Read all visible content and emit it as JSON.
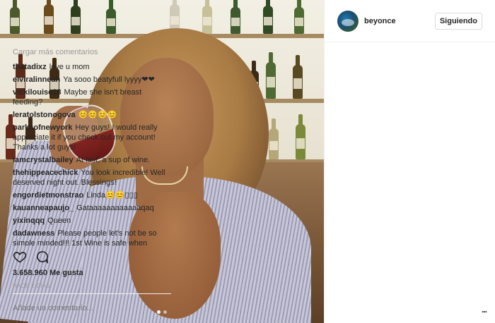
{
  "post": {
    "username": "beyonce",
    "follow_label": "Siguiendo",
    "load_more_label": "Cargar más comentarios",
    "likes_text": "3.658.960 Me gusta",
    "timestamp": "HACE 2 DÍAS",
    "comment_placeholder": "Añade un comentario...",
    "more_label": "...",
    "carousel": {
      "count": 2,
      "active_index": 0
    }
  },
  "comments": [
    {
      "user": "thatadixz",
      "text": "love u mom"
    },
    {
      "user": "elviralinneah",
      "text": "Ya sooo beatyfull lyyyy❤❤"
    },
    {
      "user": "vickilouise28",
      "text": "Maybe she isn't breast feeding?"
    },
    {
      "user": "leratolstonogova",
      "text": "😊😊😊😊"
    },
    {
      "user": "parksofnewyork",
      "text": "Hey guys! I would really appreciate it if you check out my account! Thanks a lot guys!"
    },
    {
      "user": "iamcrystalbailey",
      "text": "At last; a sup of wine."
    },
    {
      "user": "thehippeacechick",
      "text": "You look incredible! Well deserved night out. Blessings!"
    },
    {
      "user": "engordietmonstrao",
      "text": "Linda😊😊▯▯▯"
    },
    {
      "user": "kauanneараujo_",
      "text": "Gataaaaaaaaaaaaqaq"
    },
    {
      "user": "yixinqqq",
      "text": "Queen"
    },
    {
      "user": "dadawness",
      "text": "Please people let's not be so simple minded!!! 1st Wine is safe when"
    }
  ],
  "icons": {
    "like": "heart-outline-icon",
    "comment": "speech-bubble-outline-icon"
  },
  "colors": {
    "text": "#262626",
    "muted": "#999999",
    "border": "#efefef"
  }
}
